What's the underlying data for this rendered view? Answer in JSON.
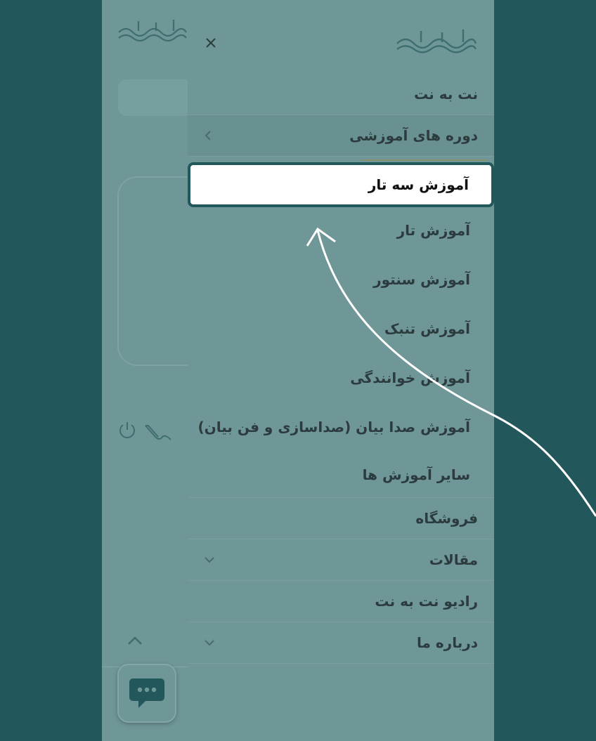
{
  "brand": {
    "logo_text": "نت به نت"
  },
  "drawer": {
    "close_label": "×",
    "menu": [
      {
        "label": "نت به نت"
      },
      {
        "label": "دوره های آموزشی",
        "has_submenu": true,
        "expanded": true
      },
      {
        "label": "فروشگاه"
      },
      {
        "label": "مقالات",
        "has_submenu": true
      },
      {
        "label": "رادیو نت به نت"
      },
      {
        "label": "درباره ما",
        "has_submenu": true
      }
    ],
    "courses_submenu": [
      {
        "label": "آموزش سه تار",
        "highlighted": true
      },
      {
        "label": "آموزش تار"
      },
      {
        "label": "آموزش سنتور"
      },
      {
        "label": "آموزش تنبک"
      },
      {
        "label": "آموزش خوانندگی"
      },
      {
        "label": "آموزش صدا بیان (صداسازی و فن بیان)"
      },
      {
        "label": "سایر آموزش ها"
      }
    ]
  },
  "icons": {
    "close": "close-icon",
    "submenu_toggle": "chevron-icon",
    "power": "power-icon",
    "signature": "signature-icon",
    "scroll_top": "chevron-up-icon",
    "chat": "chat-bubble-icon",
    "annotation_arrow": "arrow-icon"
  },
  "colors": {
    "backdrop": "#22575c",
    "overlay_surface": "#6f9798",
    "highlight_border": "#22575c",
    "highlight_fill": "#ffffff",
    "annotation_arrow": "#ffffff"
  }
}
